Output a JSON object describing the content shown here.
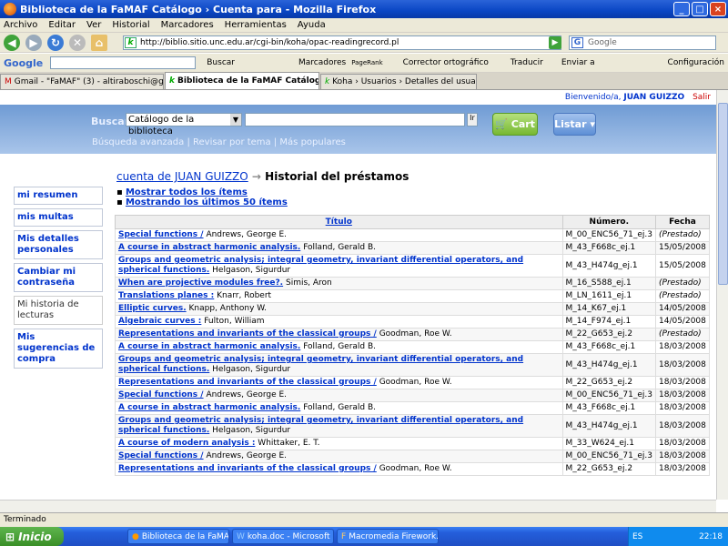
{
  "window": {
    "title": "Biblioteca de la FaMAF Catálogo › Cuenta para - Mozilla Firefox"
  },
  "menu": [
    "Archivo",
    "Editar",
    "Ver",
    "Historial",
    "Marcadores",
    "Herramientas",
    "Ayuda"
  ],
  "nav": {
    "url": "http://biblio.sitio.unc.edu.ar/cgi-bin/koha/opac-readingrecord.pl",
    "search_placeholder": "Google"
  },
  "gtoolbar": {
    "logo": "Google",
    "buscar": "Buscar",
    "marcadores": "Marcadores",
    "pagerank": "PageRank",
    "corrector": "Corrector ortográfico",
    "traducir": "Traducir",
    "enviar": "Enviar a",
    "config": "Configuración"
  },
  "tabs": [
    {
      "label": "Gmail - \"FaMAF\" (3) - altiraboschi@gma..."
    },
    {
      "label": "Biblioteca de la FaMAF Catálog..."
    },
    {
      "label": "Koha › Usuarios › Detalles del usuario..."
    }
  ],
  "page": {
    "welcome_prefix": "Bienvenido/a,",
    "welcome_user": "JUAN GUIZZO",
    "salir": "Salir",
    "buscar_label": "Buscar",
    "catalog_option": "Catálogo de la biblioteca",
    "go_label": "Ir",
    "cart": "Cart",
    "lista": "Listar ▾",
    "busqueda_avanzada": "Búsqueda avanzada",
    "revisar_tema": "Revisar por tema",
    "mas_populares": "Más populares"
  },
  "sidebar": [
    {
      "label": "mi resumen"
    },
    {
      "label": "mis multas"
    },
    {
      "label": "Mis detalles personales"
    },
    {
      "label": "Cambiar mi contraseña"
    },
    {
      "label": "Mi historia de lecturas"
    },
    {
      "label": "Mis sugerencias de compra"
    }
  ],
  "heading": {
    "account_link": "cuenta de JUAN GUIZZO",
    "arrow": "→",
    "title": "Historial del préstamos"
  },
  "options": {
    "all": "Mostrar todos los ítems",
    "last50": "Mostrando los últimos 50 ítems"
  },
  "table": {
    "headers": {
      "title": "Título",
      "number": "Número.",
      "date": "Fecha"
    },
    "rows": [
      {
        "title": "Special functions /",
        "author": "Andrews, George E.",
        "number": "M_00_ENC56_71_ej.3",
        "date": "(Prestado)"
      },
      {
        "title": "A course in abstract harmonic analysis.",
        "author": "Folland, Gerald B.",
        "number": "M_43_F668c_ej.1",
        "date": "15/05/2008"
      },
      {
        "title": "Groups and geometric analysis; integral geometry, invariant differential operators, and spherical functions.",
        "author": "Helgason, Sigurdur",
        "number": "M_43_H474g_ej.1",
        "date": "15/05/2008"
      },
      {
        "title": "When are projective modules free?.",
        "author": "Simis, Aron",
        "number": "M_16_S588_ej.1",
        "date": "(Prestado)"
      },
      {
        "title": "Translations planes :",
        "author": "Knarr, Robert",
        "number": "M_LN_1611_ej.1",
        "date": "(Prestado)"
      },
      {
        "title": "Elliptic curves.",
        "author": "Knapp, Anthony W.",
        "number": "M_14_K67_ej.1",
        "date": "14/05/2008"
      },
      {
        "title": "Algebraic curves :",
        "author": "Fulton, William",
        "number": "M_14_F974_ej.1",
        "date": "14/05/2008"
      },
      {
        "title": "Representations and invariants of the classical groups /",
        "author": "Goodman, Roe W.",
        "number": "M_22_G653_ej.2",
        "date": "(Prestado)"
      },
      {
        "title": "A course in abstract harmonic analysis.",
        "author": "Folland, Gerald B.",
        "number": "M_43_F668c_ej.1",
        "date": "18/03/2008"
      },
      {
        "title": "Groups and geometric analysis; integral geometry, invariant differential operators, and spherical functions.",
        "author": "Helgason, Sigurdur",
        "number": "M_43_H474g_ej.1",
        "date": "18/03/2008"
      },
      {
        "title": "Representations and invariants of the classical groups /",
        "author": "Goodman, Roe W.",
        "number": "M_22_G653_ej.2",
        "date": "18/03/2008"
      },
      {
        "title": "Special functions /",
        "author": "Andrews, George E.",
        "number": "M_00_ENC56_71_ej.3",
        "date": "18/03/2008"
      },
      {
        "title": "A course in abstract harmonic analysis.",
        "author": "Folland, Gerald B.",
        "number": "M_43_F668c_ej.1",
        "date": "18/03/2008"
      },
      {
        "title": "Groups and geometric analysis; integral geometry, invariant differential operators, and spherical functions.",
        "author": "Helgason, Sigurdur",
        "number": "M_43_H474g_ej.1",
        "date": "18/03/2008"
      },
      {
        "title": "A course of modern analysis :",
        "author": "Whittaker, E. T.",
        "number": "M_33_W624_ej.1",
        "date": "18/03/2008"
      },
      {
        "title": "Special functions /",
        "author": "Andrews, George E.",
        "number": "M_00_ENC56_71_ej.3",
        "date": "18/03/2008"
      },
      {
        "title": "Representations and invariants of the classical groups /",
        "author": "Goodman, Roe W.",
        "number": "M_22_G653_ej.2",
        "date": "18/03/2008"
      }
    ]
  },
  "status": "Terminado",
  "taskbar": {
    "start": "Inicio",
    "tasks": [
      "Biblioteca de la FaMA...",
      "koha.doc - Microsoft ...",
      "Macromedia Firework..."
    ],
    "lang": "ES",
    "clock": "22:18"
  }
}
